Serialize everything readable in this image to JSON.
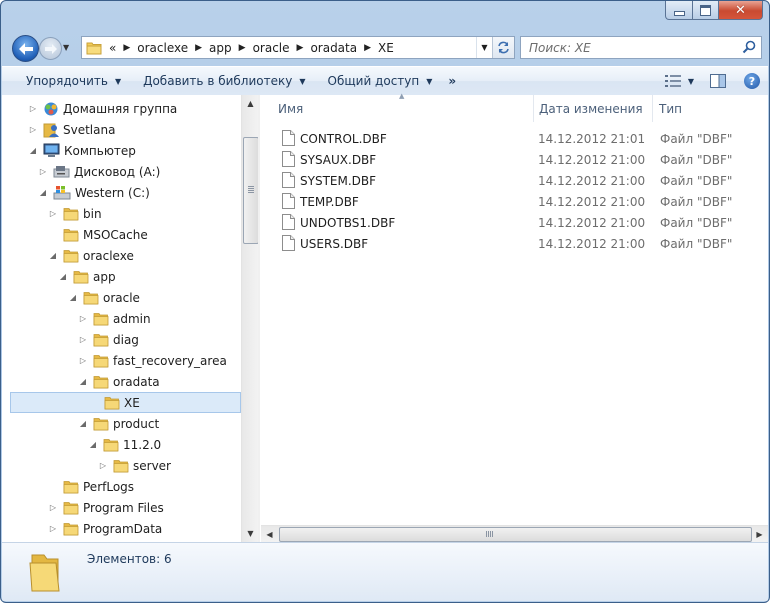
{
  "window": {
    "caption": {
      "close": "✕"
    }
  },
  "address": {
    "overflow": "«",
    "crumbs": [
      "oraclexe",
      "app",
      "oracle",
      "oradata",
      "XE"
    ]
  },
  "search": {
    "placeholder": "Поиск: XE"
  },
  "toolbar": {
    "organize": "Упорядочить",
    "add_to_library": "Добавить в библиотеку",
    "share": "Общий доступ",
    "more": "»",
    "help": "?"
  },
  "nav_tree": [
    {
      "label": "Домашняя группа",
      "icon": "homegroup-icon"
    },
    {
      "label": "Svetlana",
      "icon": "user-icon"
    },
    {
      "label": "Компьютер",
      "icon": "computer-icon"
    },
    {
      "label": "Дисковод (A:)",
      "icon": "floppy-drive-icon"
    },
    {
      "label": "Western (C:)",
      "icon": "windows-drive-icon"
    },
    {
      "label": "bin",
      "icon": "folder-icon"
    },
    {
      "label": "MSOCache",
      "icon": "folder-icon"
    },
    {
      "label": "oraclexe",
      "icon": "folder-icon"
    },
    {
      "label": "app",
      "icon": "folder-icon"
    },
    {
      "label": "oracle",
      "icon": "folder-icon"
    },
    {
      "label": "admin",
      "icon": "folder-icon"
    },
    {
      "label": "diag",
      "icon": "folder-icon"
    },
    {
      "label": "fast_recovery_area",
      "icon": "folder-icon"
    },
    {
      "label": "oradata",
      "icon": "folder-icon"
    },
    {
      "label": "XE",
      "icon": "folder-icon",
      "selected": true
    },
    {
      "label": "product",
      "icon": "folder-icon"
    },
    {
      "label": "11.2.0",
      "icon": "folder-icon"
    },
    {
      "label": "server",
      "icon": "folder-icon"
    },
    {
      "label": "PerfLogs",
      "icon": "folder-icon"
    },
    {
      "label": "Program Files",
      "icon": "folder-icon"
    },
    {
      "label": "ProgramData",
      "icon": "folder-icon"
    }
  ],
  "columns": {
    "name": "Имя",
    "date": "Дата изменения",
    "type": "Тип"
  },
  "files": [
    {
      "name": "CONTROL.DBF",
      "date": "14.12.2012 21:01",
      "type": "Файл \"DBF\""
    },
    {
      "name": "SYSAUX.DBF",
      "date": "14.12.2012 21:00",
      "type": "Файл \"DBF\""
    },
    {
      "name": "SYSTEM.DBF",
      "date": "14.12.2012 21:00",
      "type": "Файл \"DBF\""
    },
    {
      "name": "TEMP.DBF",
      "date": "14.12.2012 21:00",
      "type": "Файл \"DBF\""
    },
    {
      "name": "UNDOTBS1.DBF",
      "date": "14.12.2012 21:00",
      "type": "Файл \"DBF\""
    },
    {
      "name": "USERS.DBF",
      "date": "14.12.2012 21:00",
      "type": "Файл \"DBF\""
    }
  ],
  "details": {
    "item_count": "Элементов: 6"
  },
  "colors": {
    "selection": "#dbeaf9",
    "folder": "#f3cd5b",
    "chrome": "#b9d1ea"
  }
}
